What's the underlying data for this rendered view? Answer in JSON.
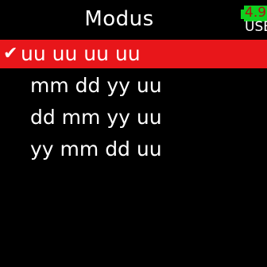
{
  "header": {
    "title": "Modus"
  },
  "battery": {
    "level": "4.9",
    "source": "USB"
  },
  "menu": {
    "items": [
      {
        "label": "uu uu uu uu",
        "selected": true
      },
      {
        "label": "mm dd yy uu",
        "selected": false
      },
      {
        "label": "dd mm yy uu",
        "selected": false
      },
      {
        "label": "yy mm dd uu",
        "selected": false
      }
    ],
    "check_icon": "check-icon"
  },
  "colors": {
    "background": "#000000",
    "selection": "#e8161a",
    "battery": "#10d020",
    "battery_text": "#b01010",
    "text": "#ffffff"
  }
}
